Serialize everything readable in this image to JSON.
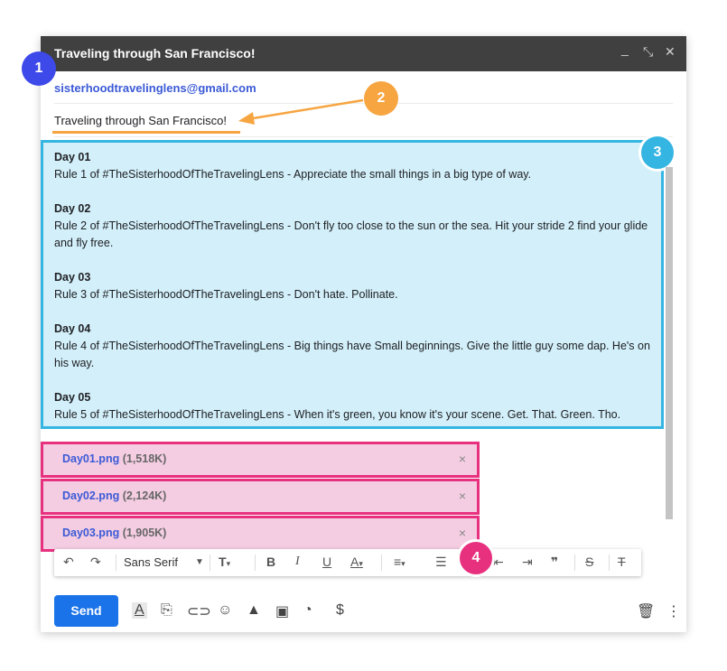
{
  "window": {
    "title": "Traveling through San Francisco!",
    "minimize_glyph": "_",
    "expand_glyph": "⤡",
    "close_glyph": "✕"
  },
  "from": {
    "email": "sisterhoodtravelinglens@gmail.com"
  },
  "subject": {
    "value": "Traveling through San Francisco!"
  },
  "badges": [
    "1",
    "2",
    "3",
    "4"
  ],
  "colors": {
    "badge1": "#3d49e8",
    "badge2": "#f6a541",
    "badge3": "#35b5e2",
    "badge4": "#e7317f",
    "send": "#1a73e8"
  },
  "body": {
    "days": [
      {
        "heading": "Day 01",
        "text": "Rule 1 of #TheSisterhoodOfTheTravelingLens - Appreciate the small things in a big type of way."
      },
      {
        "heading": "Day 02",
        "text": "Rule 2 of #TheSisterhoodOfTheTravelingLens - Don't fly too close to the sun or the sea. Hit your stride 2 find your glide and fly free."
      },
      {
        "heading": "Day 03",
        "text": "Rule 3 of #TheSisterhoodOfTheTravelingLens - Don't hate. Pollinate."
      },
      {
        "heading": "Day 04",
        "text": "Rule 4 of #TheSisterhoodOfTheTravelingLens - Big things have Small beginnings. Give the little guy some dap. He's on his way."
      },
      {
        "heading": "Day 05",
        "text": "Rule 5 of #TheSisterhoodOfTheTravelingLens - When it's green, you know it's your scene. Get. That. Green. Tho."
      }
    ]
  },
  "attachments": [
    {
      "name": "Day01.png",
      "size": "(1,518K)",
      "remove": "×"
    },
    {
      "name": "Day02.png",
      "size": "(2,124K)",
      "remove": "×"
    },
    {
      "name": "Day03.png",
      "size": "(1,905K)",
      "remove": "×"
    }
  ],
  "toolbar": {
    "font": "Sans Serif",
    "icons": [
      "undo-icon",
      "redo-icon",
      "font-size-icon",
      "bold-icon",
      "italic-icon",
      "underline-icon",
      "text-color-icon",
      "align-icon",
      "numbered-list-icon",
      "indent-less-icon",
      "indent-more-icon",
      "quote-icon",
      "strikethrough-icon",
      "clear-formatting-icon"
    ]
  },
  "bottom": {
    "send_label": "Send",
    "icons": [
      "formatting-options-icon",
      "attach-icon",
      "link-icon",
      "emoji-icon",
      "drive-icon",
      "photo-icon",
      "confidential-icon",
      "money-icon",
      "trash-icon",
      "more-options-icon"
    ]
  }
}
